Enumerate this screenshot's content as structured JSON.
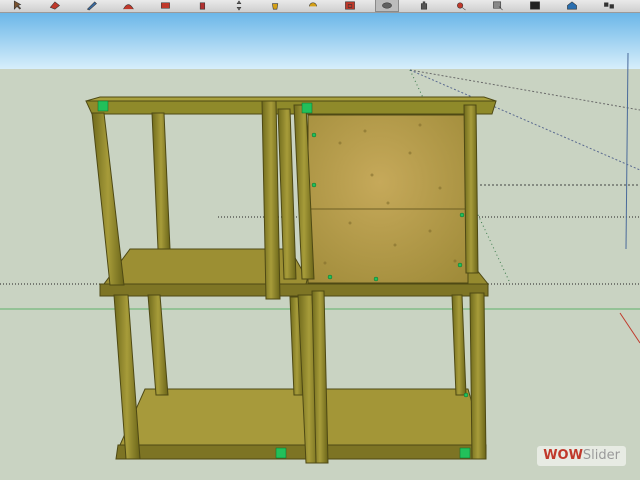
{
  "toolbar": {
    "tools": [
      {
        "name": "select-tool",
        "icon": "arrow-icon",
        "color": "#7a5230"
      },
      {
        "name": "eraser-tool",
        "icon": "eraser-icon",
        "color": "#c0392b"
      },
      {
        "name": "line-tool",
        "icon": "pencil-icon",
        "color": "#3a6aa0"
      },
      {
        "name": "arc-tool",
        "icon": "arc-icon",
        "color": "#c0392b"
      },
      {
        "name": "shape-tool",
        "icon": "rectangle-icon",
        "color": "#c0392b"
      },
      {
        "name": "push-pull-tool",
        "icon": "push-pull-icon",
        "color": "#b03030"
      },
      {
        "name": "move-tool",
        "icon": "move-icon",
        "color": "#6a6a6a"
      },
      {
        "name": "paint-tool",
        "icon": "paint-bucket-icon",
        "color": "#d4a017"
      },
      {
        "name": "rotate-tool",
        "icon": "rotate-icon",
        "color": "#d4a017"
      },
      {
        "name": "offset-tool",
        "icon": "offset-icon",
        "color": "#c0392b"
      },
      {
        "name": "orbit-tool",
        "icon": "orbit-icon",
        "color": "#606060"
      },
      {
        "name": "pan-tool",
        "icon": "hand-icon",
        "color": "#555555"
      },
      {
        "name": "zoom-tool",
        "icon": "magnifier-icon",
        "color": "#c0392b"
      },
      {
        "name": "zoom-window-tool",
        "icon": "zoom-window-icon",
        "color": "#888888"
      },
      {
        "name": "zoom-extents-tool",
        "icon": "zoom-extents-icon",
        "color": "#222222"
      },
      {
        "name": "3d-warehouse-tool",
        "icon": "warehouse-icon",
        "color": "#2a6fb0"
      },
      {
        "name": "components-tool",
        "icon": "components-icon",
        "color": "#333333"
      }
    ]
  },
  "viewport": {
    "sky_color": "#a9d6f0",
    "ground_color": "#c9d3c2",
    "wood_color": "#8f8a2a",
    "board_color": "#a79a3b",
    "panel_color": "#b59b4a",
    "endpoint_color": "#22c05a"
  },
  "watermark": {
    "brand": "WOW",
    "rest": "Slider"
  }
}
